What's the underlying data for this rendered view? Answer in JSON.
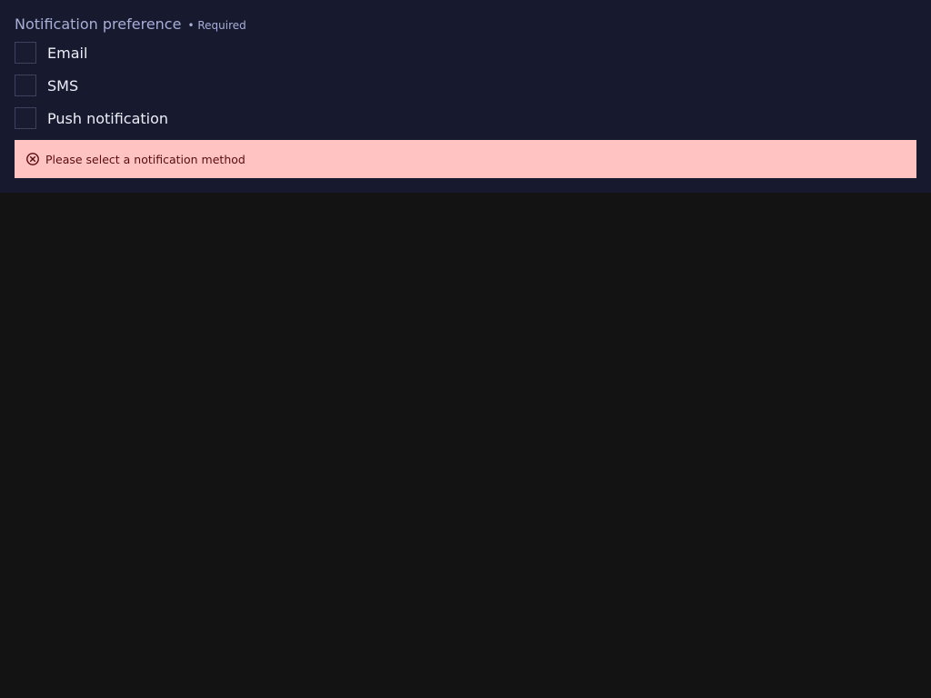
{
  "fieldset": {
    "title": "Notification preference",
    "required_text": "• Required"
  },
  "options": [
    {
      "label": "Email",
      "checked": false
    },
    {
      "label": "SMS",
      "checked": false
    },
    {
      "label": "Push notification",
      "checked": false
    }
  ],
  "error": {
    "icon": "error-circle-x-icon",
    "message": "Please select a notification method"
  },
  "colors": {
    "panel_bg": "#171a2e",
    "page_bg": "#131313",
    "error_bg": "#ffc4c2",
    "error_text": "#5a0a12",
    "muted_text": "#a9aed6"
  }
}
